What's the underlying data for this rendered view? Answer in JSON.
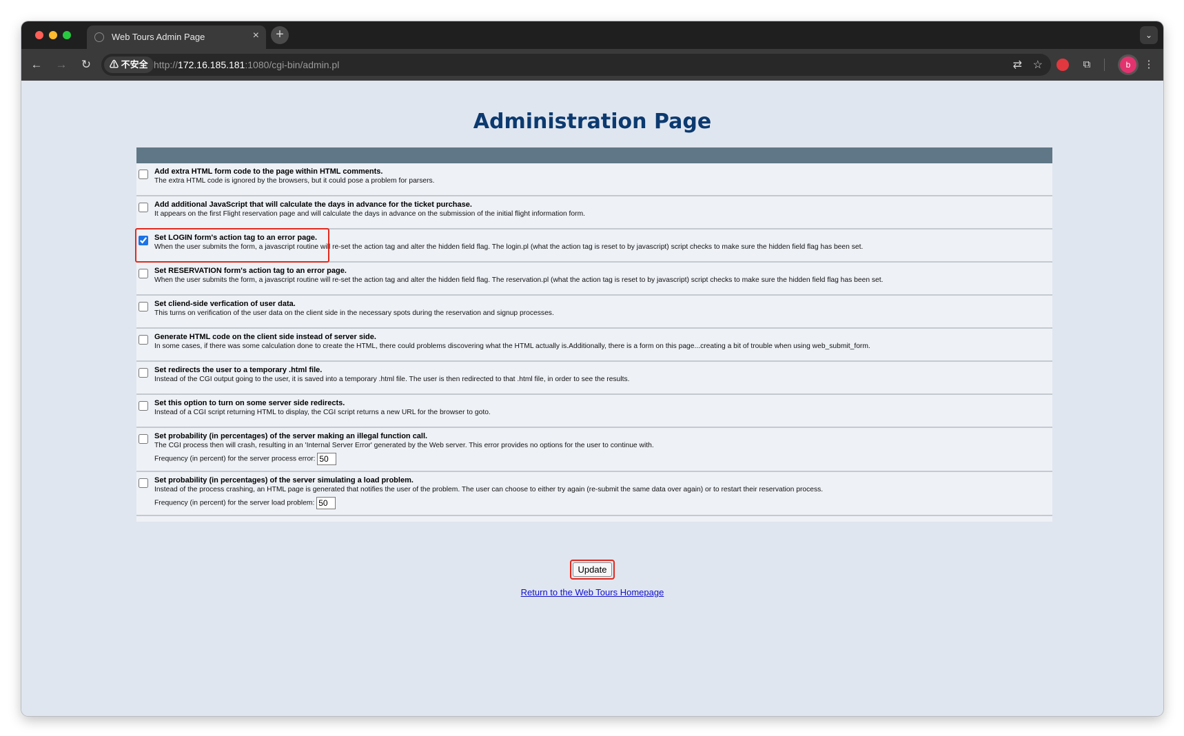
{
  "browser": {
    "tab_title": "Web Tours Admin Page",
    "tab_close": "×",
    "new_tab": "+",
    "tab_dropdown": "⌄",
    "insecure_label": "⚠ 不安全",
    "url_prefix": "http://",
    "url_host": "172.16.185.181",
    "url_rest": ":1080/cgi-bin/admin.pl",
    "avatar_letter": "b"
  },
  "page": {
    "title": "Administration Page",
    "options": [
      {
        "title": "Add extra HTML form code to the page within HTML comments.",
        "desc": "The extra HTML code is ignored by the browsers, but it could pose a problem for parsers.",
        "checked": false
      },
      {
        "title": "Add additional JavaScript that will calculate the days in advance for the ticket purchase.",
        "desc": "It appears on the first Flight reservation page and will calculate the days in advance on the submission of the initial flight information form.",
        "checked": false
      },
      {
        "title": "Set LOGIN form's action tag to an error page.",
        "desc": "When the user submits the form, a javascript routine will re-set the action tag and alter the hidden field flag. The login.pl (what the action tag is reset to by javascript) script checks to make sure the hidden field flag has been set.",
        "checked": true
      },
      {
        "title": "Set RESERVATION form's action tag to an error page.",
        "desc": "When the user submits the form, a javascript routine will re-set the action tag and alter the hidden field flag. The reservation.pl (what the action tag is reset to by javascript) script checks to make sure the hidden field flag has been set.",
        "checked": false
      },
      {
        "title": "Set cliend-side verfication of user data.",
        "desc": "This turns on verification of the user data on the client side in the necessary spots during the reservation and signup processes.",
        "checked": false
      },
      {
        "title": "Generate HTML code on the client side instead of server side.",
        "desc": "In some cases, if there was some calculation done to create the HTML, there could problems discovering what the HTML actually is.Additionally, there is a form on this page...creating a bit of trouble when using web_submit_form.",
        "checked": false
      },
      {
        "title": "Set redirects the user to a temporary .html file.",
        "desc": "Instead of the CGI output going to the user, it is saved into a temporary .html file. The user is then redirected to that .html file, in order to see the results.",
        "checked": false
      },
      {
        "title": "Set this option to turn on some server side redirects.",
        "desc": "Instead of a CGI script returning HTML to display, the CGI script returns a new URL for the browser to goto.",
        "checked": false
      },
      {
        "title": "Set probability (in percentages) of the server making an illegal function call.",
        "desc": "The CGI process then will crash, resulting in an 'Internal Server Error' generated by the Web server. This error provides no options for the user to continue with.",
        "freq_label": "Frequency (in percent) for the server process error:",
        "freq_value": "50",
        "checked": false
      },
      {
        "title": "Set probability (in percentages) of the server simulating a load problem.",
        "desc": "Instead of the process crashing, an HTML page is generated that notifies the user of the problem. The user can choose to either try again (re-submit the same data over again) or to restart their reservation process.",
        "freq_label": "Frequency (in percent) for the server load problem:",
        "freq_value": "50",
        "checked": false
      }
    ],
    "update_label": "Update",
    "return_link": "Return to the Web Tours Homepage"
  },
  "colors": {
    "page_bg": "#e0e6ef",
    "title": "#0c3a70",
    "table_header": "#5f7786",
    "highlight": "#e1291d",
    "link": "#1010cc"
  }
}
